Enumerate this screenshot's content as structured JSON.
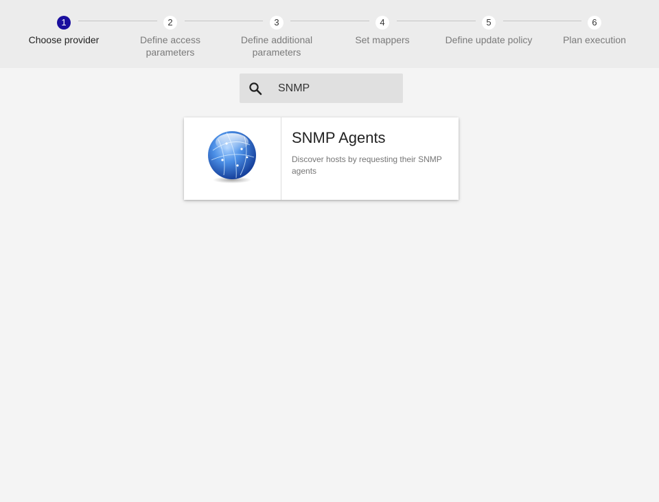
{
  "stepper": {
    "steps": [
      {
        "number": "1",
        "label": "Choose provider"
      },
      {
        "number": "2",
        "label": "Define access parameters"
      },
      {
        "number": "3",
        "label": "Define additional parameters"
      },
      {
        "number": "4",
        "label": "Set mappers"
      },
      {
        "number": "5",
        "label": "Define update policy"
      },
      {
        "number": "6",
        "label": "Plan execution"
      }
    ],
    "active_color": "#1a0f9e"
  },
  "search": {
    "value": "SNMP",
    "icon": "search-icon"
  },
  "providers": [
    {
      "title": "SNMP Agents",
      "description": "Discover hosts by requesting their SNMP agents",
      "icon": "globe-icon"
    }
  ]
}
